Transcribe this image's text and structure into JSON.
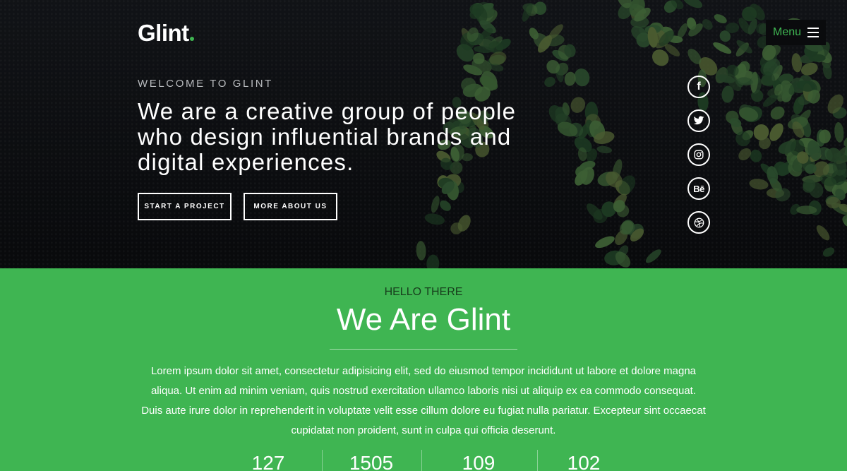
{
  "colors": {
    "accent": "#3fb552",
    "hero_bg": "#0c0e11",
    "eyebrow": "#173d1c",
    "text_light": "#ffffff"
  },
  "brand": {
    "logo_text": "Glint"
  },
  "nav": {
    "menu_label": "Menu",
    "menu_icon": "hamburger-icon"
  },
  "hero": {
    "welcome": "WELCOME TO GLINT",
    "headline": "We are a creative group of people who design influential brands and digital experiences.",
    "buttons": [
      {
        "label": "START A PROJECT"
      },
      {
        "label": "MORE ABOUT US"
      }
    ],
    "social": [
      {
        "icon": "facebook-icon",
        "glyph": "f"
      },
      {
        "icon": "twitter-icon"
      },
      {
        "icon": "instagram-icon"
      },
      {
        "icon": "behance-icon",
        "glyph": "Bē"
      },
      {
        "icon": "dribbble-icon"
      }
    ]
  },
  "about": {
    "eyebrow": "HELLO THERE",
    "title": "We Are Glint",
    "paragraph": "Lorem ipsum dolor sit amet, consectetur adipisicing elit, sed do eiusmod tempor incididunt ut labore et dolore magna aliqua. Ut enim ad minim veniam, quis nostrud exercitation ullamco laboris nisi ut aliquip ex ea commodo consequat. Duis aute irure dolor in reprehenderit in voluptate velit esse cillum dolore eu fugiat nulla pariatur. Excepteur sint occaecat cupidatat non proident, sunt in culpa qui officia deserunt.",
    "stats": [
      "127",
      "1505",
      "109",
      "102"
    ]
  }
}
